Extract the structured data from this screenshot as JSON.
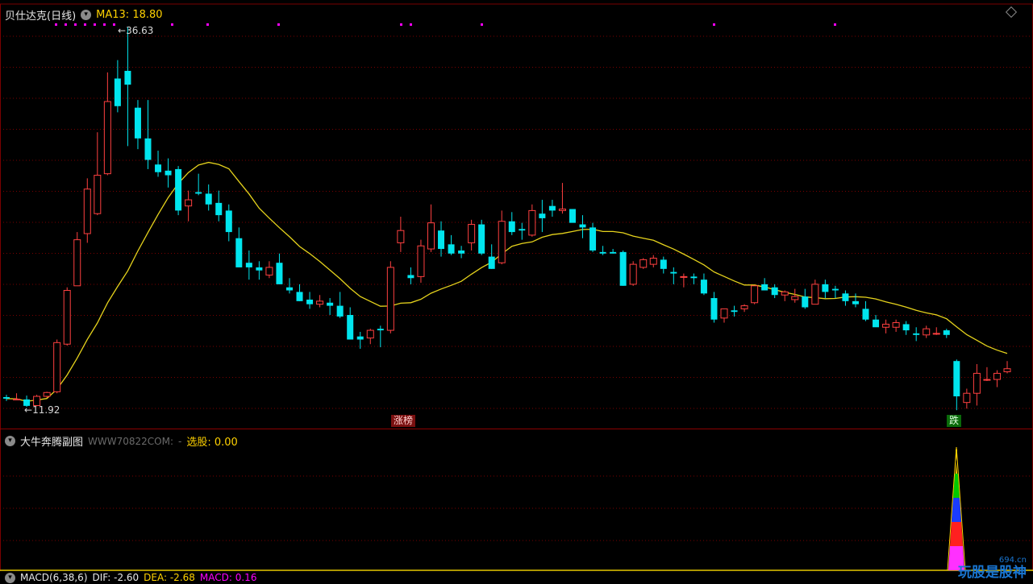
{
  "main": {
    "title": "贝仕达克(日线)",
    "ma_label": "MA13: 18.80",
    "high_label": "36.63",
    "low_label": "11.92",
    "tag_limit_up": "涨榜",
    "tag_fall": "跌"
  },
  "sub": {
    "title": "大牛奔腾副图",
    "watermark_site": "WWW70822COM:",
    "select_label": "选股: 0.00"
  },
  "macd": {
    "name": "MACD(6,38,6)",
    "dif": "DIF: -2.60",
    "dea": "DEA: -2.68",
    "macd": "MACD: 0.16"
  },
  "watermark": {
    "text": "玩股是股神",
    "domain": "694.cn"
  },
  "colors": {
    "up": "#ff4040",
    "down": "#00e5ee",
    "ma": "#e6d31c",
    "grid": "#7a0000",
    "marker": "#ff00ff"
  },
  "chart_data": {
    "type": "candlestick",
    "price_range": [
      11.92,
      36.63
    ],
    "ma13_last": 18.8,
    "candles_ohlc": [
      [
        12.55,
        12.7,
        12.3,
        12.45
      ],
      [
        12.4,
        12.8,
        12.35,
        12.42
      ],
      [
        12.4,
        12.65,
        11.92,
        11.98
      ],
      [
        12.0,
        12.7,
        11.95,
        12.6
      ],
      [
        12.6,
        12.9,
        12.5,
        12.85
      ],
      [
        12.9,
        16.3,
        12.8,
        16.1
      ],
      [
        16.0,
        19.7,
        15.9,
        19.5
      ],
      [
        19.8,
        23.3,
        21.6,
        22.8
      ],
      [
        23.2,
        26.8,
        22.6,
        26.1
      ],
      [
        24.5,
        29.8,
        24.4,
        27.0
      ],
      [
        27.1,
        33.7,
        27.0,
        31.8
      ],
      [
        33.3,
        34.5,
        31.1,
        31.5
      ],
      [
        33.8,
        36.63,
        28.9,
        32.9
      ],
      [
        31.4,
        31.9,
        28.7,
        29.4
      ],
      [
        29.4,
        31.9,
        27.4,
        28.0
      ],
      [
        27.7,
        28.6,
        26.9,
        27.2
      ],
      [
        27.3,
        28.1,
        26.2,
        27.0
      ],
      [
        27.4,
        27.6,
        24.4,
        24.7
      ],
      [
        25.0,
        26.0,
        24.0,
        25.4
      ],
      [
        25.9,
        27.1,
        25.7,
        25.8
      ],
      [
        25.8,
        26.4,
        24.7,
        25.1
      ],
      [
        25.2,
        26.0,
        24.0,
        24.4
      ],
      [
        24.7,
        25.1,
        22.7,
        23.3
      ],
      [
        22.9,
        23.6,
        21.8,
        21.0
      ],
      [
        21.3,
        22.1,
        20.2,
        21.0
      ],
      [
        21.0,
        21.4,
        20.2,
        20.8
      ],
      [
        20.5,
        21.4,
        20.3,
        21.0
      ],
      [
        21.3,
        21.9,
        19.9,
        19.9
      ],
      [
        19.7,
        20.3,
        19.3,
        19.5
      ],
      [
        19.4,
        19.9,
        18.8,
        18.8
      ],
      [
        18.9,
        19.4,
        18.3,
        18.6
      ],
      [
        18.6,
        19.2,
        18.4,
        18.8
      ],
      [
        18.7,
        19.0,
        17.9,
        18.5
      ],
      [
        18.5,
        19.4,
        17.7,
        17.8
      ],
      [
        17.9,
        18.4,
        16.4,
        16.3
      ],
      [
        16.5,
        16.8,
        15.7,
        16.3
      ],
      [
        16.4,
        17.0,
        16.0,
        16.9
      ],
      [
        17.0,
        17.2,
        15.8,
        16.9
      ],
      [
        16.9,
        21.4,
        16.7,
        21.0
      ],
      [
        22.6,
        24.3,
        22.0,
        23.4
      ],
      [
        20.5,
        21.0,
        19.9,
        20.3
      ],
      [
        20.4,
        22.8,
        20.0,
        22.4
      ],
      [
        22.2,
        25.1,
        22.0,
        23.9
      ],
      [
        23.4,
        24.0,
        21.7,
        22.2
      ],
      [
        22.5,
        23.1,
        21.8,
        21.9
      ],
      [
        22.1,
        22.4,
        21.6,
        21.9
      ],
      [
        22.6,
        24.1,
        22.1,
        23.8
      ],
      [
        23.8,
        24.1,
        21.8,
        21.9
      ],
      [
        21.7,
        22.5,
        20.9,
        20.9
      ],
      [
        21.3,
        24.7,
        21.2,
        24.0
      ],
      [
        24.0,
        24.6,
        23.1,
        23.3
      ],
      [
        23.5,
        23.9,
        22.8,
        23.4
      ],
      [
        23.1,
        25.1,
        23.0,
        24.7
      ],
      [
        24.5,
        25.4,
        23.3,
        24.2
      ],
      [
        25.0,
        25.4,
        24.3,
        24.7
      ],
      [
        24.7,
        26.5,
        24.5,
        24.8
      ],
      [
        24.8,
        24.2,
        24.0,
        23.9
      ],
      [
        23.8,
        24.4,
        22.9,
        23.6
      ],
      [
        23.6,
        23.9,
        22.0,
        22.1
      ],
      [
        22.0,
        22.4,
        21.8,
        21.9
      ],
      [
        22.0,
        22.2,
        21.9,
        21.9
      ],
      [
        22.0,
        22.1,
        19.8,
        19.8
      ],
      [
        19.9,
        21.4,
        19.8,
        21.2
      ],
      [
        21.0,
        21.6,
        20.9,
        21.5
      ],
      [
        21.2,
        21.8,
        21.0,
        21.6
      ],
      [
        21.5,
        21.7,
        20.6,
        20.9
      ],
      [
        20.7,
        21.0,
        19.9,
        20.6
      ],
      [
        20.4,
        20.6,
        19.7,
        20.4
      ],
      [
        20.4,
        20.6,
        19.9,
        20.3
      ],
      [
        20.2,
        20.6,
        19.2,
        19.3
      ],
      [
        19.0,
        19.4,
        17.4,
        17.6
      ],
      [
        17.7,
        18.2,
        17.4,
        18.3
      ],
      [
        18.2,
        18.5,
        17.8,
        18.1
      ],
      [
        18.3,
        18.6,
        18.1,
        18.5
      ],
      [
        18.7,
        19.7,
        18.6,
        19.8
      ],
      [
        19.9,
        20.3,
        19.7,
        19.5
      ],
      [
        19.7,
        19.9,
        19.0,
        19.2
      ],
      [
        19.2,
        19.5,
        18.8,
        19.4
      ],
      [
        18.9,
        19.6,
        18.7,
        19.1
      ],
      [
        19.1,
        19.6,
        18.3,
        18.4
      ],
      [
        18.6,
        20.2,
        18.6,
        19.9
      ],
      [
        19.9,
        20.2,
        19.0,
        19.4
      ],
      [
        19.6,
        19.8,
        19.0,
        19.5
      ],
      [
        19.3,
        19.5,
        18.5,
        18.8
      ],
      [
        18.8,
        19.3,
        18.4,
        18.6
      ],
      [
        18.3,
        18.8,
        17.5,
        17.6
      ],
      [
        17.6,
        17.9,
        17.2,
        17.1
      ],
      [
        17.1,
        17.6,
        16.7,
        17.3
      ],
      [
        17.1,
        17.6,
        16.8,
        17.4
      ],
      [
        17.3,
        17.5,
        16.6,
        16.9
      ],
      [
        16.7,
        17.1,
        16.2,
        16.6
      ],
      [
        16.6,
        17.2,
        16.4,
        17.0
      ],
      [
        16.7,
        17.1,
        16.6,
        16.7
      ],
      [
        16.9,
        17.0,
        16.4,
        16.6
      ],
      [
        14.9,
        15.0,
        11.7,
        12.6
      ],
      [
        12.2,
        13.1,
        11.8,
        12.8
      ],
      [
        12.8,
        14.7,
        12.0,
        14.1
      ],
      [
        13.7,
        14.5,
        13.6,
        13.7
      ],
      [
        13.7,
        14.3,
        13.2,
        14.1
      ],
      [
        14.2,
        14.9,
        14.1,
        14.4
      ]
    ]
  }
}
